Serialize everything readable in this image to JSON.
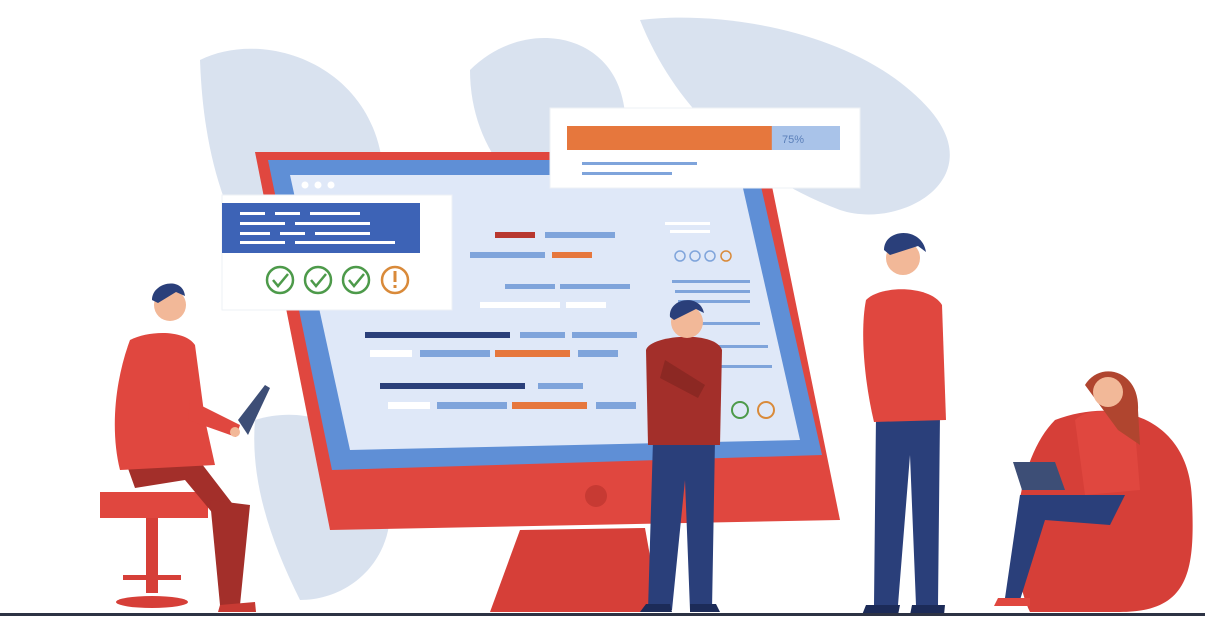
{
  "progress": {
    "label": "75%",
    "fraction": 0.75
  },
  "checklist": {
    "items": [
      {
        "status": "approved",
        "icon": "check-icon"
      },
      {
        "status": "approved",
        "icon": "check-icon"
      },
      {
        "status": "approved",
        "icon": "check-icon"
      },
      {
        "status": "warning",
        "icon": "exclamation-icon"
      }
    ]
  },
  "colors": {
    "accent_red": "#e0473f",
    "navy": "#2a3f7a",
    "screen_blue": "#dfe8f8",
    "orange": "#e6773d",
    "leaf": "#d7e0ee",
    "check_green": "#4d9a4a",
    "warning_orange": "#d98a3a"
  }
}
